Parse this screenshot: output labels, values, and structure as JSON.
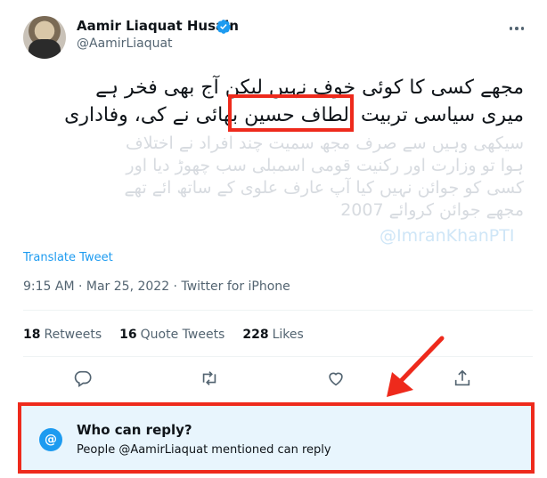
{
  "tweet": {
    "author_name": "Aamir Liaquat Husain",
    "handle": "@AamirLiaquat",
    "text_line1": "مجھے کسی کا کوئی خوف نہیں لیکن آج بھی فخر ہے",
    "text_line2": "میری سیاسی تربیت الطاف حسین بھائی نے کی، وفاداری",
    "faded_line1": "سیکھی وہیں سے صرف مجھ سمیت چند افراد نے اختلاف",
    "faded_line2": "ہوا تو وزارت اور رکنیت قومی اسمبلی سب چھوڑ دیا اور",
    "faded_line3": "کسی کو جوائن نہیں کیا آپ عارف علوی کے ساتھ ائے تھے",
    "faded_line4": "مجھے جوائن کروائے 2007",
    "faded_mention": "@ImranKhanPTI",
    "translate_label": "Translate Tweet",
    "timestamp": "9:15 AM · Mar 25, 2022 · ",
    "source": "Twitter for iPhone"
  },
  "stats": {
    "retweets_count": "18",
    "retweets_label": "Retweets",
    "quotes_count": "16",
    "quotes_label": "Quote Tweets",
    "likes_count": "228",
    "likes_label": "Likes"
  },
  "reply_settings": {
    "icon": "@",
    "title": "Who can reply?",
    "subtitle": "People @AamirLiaquat mentioned can reply"
  },
  "icons": [
    "verified-badge-icon",
    "more-icon",
    "reply-icon",
    "retweet-icon",
    "like-icon",
    "share-icon",
    "at-icon",
    "red-arrow"
  ],
  "colors": {
    "accent": "#1d9bf0",
    "annotation": "#ee2a1c",
    "reply_bg": "#e8f5fd",
    "secondary_text": "#536471"
  }
}
